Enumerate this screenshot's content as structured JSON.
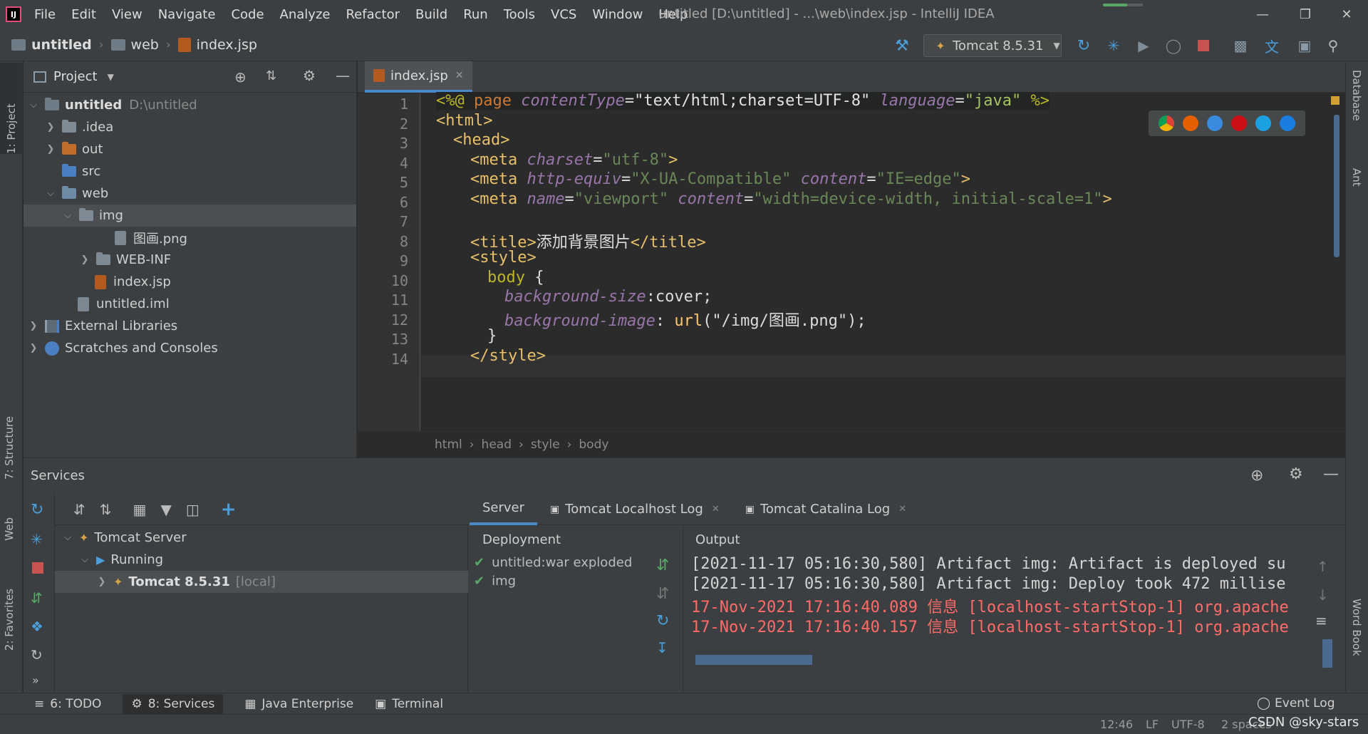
{
  "menu": [
    "File",
    "Edit",
    "View",
    "Navigate",
    "Code",
    "Analyze",
    "Refactor",
    "Build",
    "Run",
    "Tools",
    "VCS",
    "Window",
    "Help"
  ],
  "window_title": "untitled [D:\\untitled] - ...\\web\\index.jsp - IntelliJ IDEA",
  "nav_breadcrumbs": [
    "untitled",
    "web",
    "index.jsp"
  ],
  "run_config": "Tomcat 8.5.31",
  "left_stripe": [
    "1: Project",
    "7: Structure",
    "Web",
    "2: Favorites"
  ],
  "right_stripe": [
    "Database",
    "Ant",
    "Word Book"
  ],
  "project_panel": {
    "title": "Project",
    "tree": [
      {
        "label": "untitled",
        "extra": "D:\\untitled"
      },
      {
        "label": ".idea"
      },
      {
        "label": "out"
      },
      {
        "label": "src"
      },
      {
        "label": "web"
      },
      {
        "label": "img"
      },
      {
        "label": "图画.png"
      },
      {
        "label": "WEB-INF"
      },
      {
        "label": "index.jsp"
      },
      {
        "label": "untitled.iml"
      },
      {
        "label": "External Libraries"
      },
      {
        "label": "Scratches and Consoles"
      }
    ]
  },
  "editor": {
    "tab": "index.jsp",
    "line_numbers": [
      "1",
      "2",
      "3",
      "4",
      "5",
      "6",
      "7",
      "8",
      "9",
      "10",
      "11",
      "12",
      "13",
      "14"
    ],
    "lines": {
      "l1": {
        "a": "<%@ ",
        "b": "page ",
        "c": "contentType",
        "d": "=",
        "e": "\"text/html;charset=UTF-8\"",
        "f": " ",
        "g": "language",
        "h": "=",
        "i": "\"java\"",
        "j": " %>"
      },
      "l2": "<html>",
      "l3": "<head>",
      "l4": {
        "a": "<meta ",
        "b": "charset",
        "c": "=",
        "d": "\"utf-8\"",
        "e": ">"
      },
      "l5": {
        "a": "<meta ",
        "b": "http-equiv",
        "c": "=",
        "d": "\"X-UA-Compatible\"",
        "e": " ",
        "f": "content",
        "g": "=",
        "h": "\"IE=edge\"",
        "i": ">"
      },
      "l6": {
        "a": "<meta ",
        "b": "name",
        "c": "=",
        "d": "\"viewport\"",
        "e": " ",
        "f": "content",
        "g": "=",
        "h": "\"width=device-width, initial-scale=1\"",
        "i": ">"
      },
      "l8": {
        "a": "<title>",
        "b": "添加背景图片",
        "c": "</title>"
      },
      "l9": "<style>",
      "l10": {
        "a": "body",
        "b": " {"
      },
      "l11": {
        "a": "background-size",
        "b": ":cover;"
      },
      "l12": {
        "a": "background-image",
        "b": ": ",
        "c": "url",
        "d": "(\"/img/图画.png\");"
      },
      "l13": "}",
      "l14": "</style>"
    },
    "breadcrumb": [
      "html",
      "head",
      "style",
      "body"
    ]
  },
  "services": {
    "title": "Services",
    "tree": [
      {
        "label": "Tomcat Server"
      },
      {
        "label": "Running"
      },
      {
        "label": "Tomcat 8.5.31",
        "extra": "[local]"
      }
    ],
    "tabs": [
      "Server",
      "Tomcat Localhost Log",
      "Tomcat Catalina Log"
    ],
    "deployment_header": "Deployment",
    "deployments": [
      "untitled:war exploded",
      "img"
    ],
    "output_header": "Output",
    "output_lines": [
      "[2021-11-17 05:16:30,580] Artifact img: Artifact is deployed su",
      "[2021-11-17 05:16:30,580] Artifact img: Deploy took 472 millise",
      "17-Nov-2021 17:16:40.089 信息 [localhost-startStop-1] org.apache",
      "17-Nov-2021 17:16:40.157 信息 [localhost-startStop-1] org.apache"
    ]
  },
  "bottom_tools": [
    "6: TODO",
    "8: Services",
    "Java Enterprise",
    "Terminal"
  ],
  "event_log": "Event Log",
  "status": {
    "position": "12:46",
    "line_sep": "LF",
    "encoding": "UTF-8",
    "indent": "2 spaces"
  },
  "watermark": "CSDN @sky-stars",
  "colors": {
    "accent": "#4a88c7",
    "tag": "#e8bf6a",
    "string": "#6a8759",
    "attribute": "#9876aa",
    "error_text": "#ff6b68",
    "check": "#59a869"
  }
}
